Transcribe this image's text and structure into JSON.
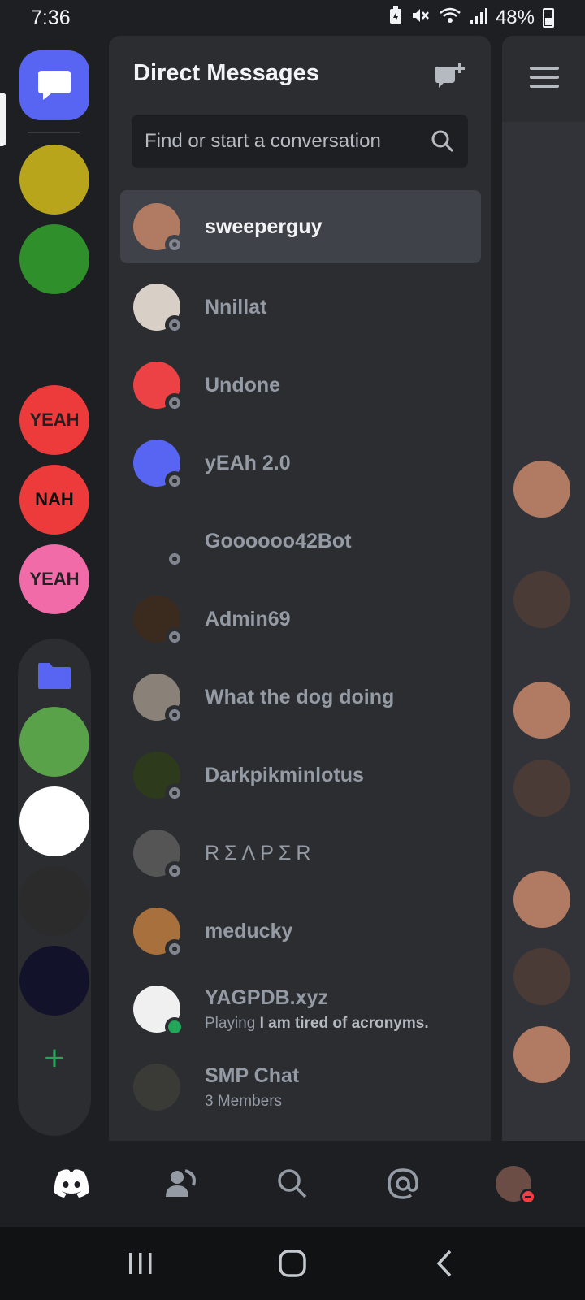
{
  "status_bar": {
    "time": "7:36",
    "battery": "48%"
  },
  "dm_panel": {
    "title": "Direct Messages",
    "search_placeholder": "Find or start a conversation"
  },
  "servers": [
    {
      "name": "server-yellow-pixel",
      "color": "#b8a51b",
      "text": ""
    },
    {
      "name": "server-green-creeper",
      "color": "#2f8f2b",
      "text": ""
    },
    {
      "name": "server-snake",
      "color": "#1e1f22",
      "text": ""
    },
    {
      "name": "server-yeah",
      "color": "#ed3a3a",
      "text": "YEAH"
    },
    {
      "name": "server-nah",
      "color": "#ed3a3a",
      "text": "NAH"
    },
    {
      "name": "server-yeah-pink",
      "color": "#f06ba8",
      "text": "YEAH"
    }
  ],
  "folder_servers": [
    {
      "name": "server-minecraft",
      "color": "#5aa24a"
    },
    {
      "name": "server-ramen",
      "color": "#ffffff"
    },
    {
      "name": "server-d-logo",
      "color": "#2b2b2b"
    },
    {
      "name": "server-galaxy",
      "color": "#12132a"
    }
  ],
  "dms": [
    {
      "name": "sweeperguy",
      "sub": "",
      "status": "offline",
      "active": true,
      "color": "#b07a63"
    },
    {
      "name": "Nnillat",
      "sub": "",
      "status": "offline",
      "active": false,
      "color": "#d8cfc7"
    },
    {
      "name": "Undone",
      "sub": "",
      "status": "offline",
      "active": false,
      "color": "#ed4245"
    },
    {
      "name": "yEAh 2.0",
      "sub": "",
      "status": "offline",
      "active": false,
      "color": "#5865f2"
    },
    {
      "name": "Goooooo42Bot",
      "sub": "",
      "status": "offline",
      "active": false,
      "color": "#2b2d31"
    },
    {
      "name": "Admin69",
      "sub": "",
      "status": "offline",
      "active": false,
      "color": "#3b2a1e"
    },
    {
      "name": "What the dog doing",
      "sub": "",
      "status": "offline",
      "active": false,
      "color": "#8a8279"
    },
    {
      "name": "Darkpikminlotus",
      "sub": "",
      "status": "offline",
      "active": false,
      "color": "#2e3a1c"
    },
    {
      "name": "RΣΛPΣR",
      "sub": "",
      "status": "offline",
      "active": false,
      "color": "#555555"
    },
    {
      "name": "meducky",
      "sub": "",
      "status": "offline",
      "active": false,
      "color": "#a8703c"
    },
    {
      "name": "YAGPDB.xyz",
      "sub_prefix": "Playing",
      "sub": "I am tired of acronyms.",
      "status": "online",
      "active": false,
      "color": "#f0f0f0"
    },
    {
      "name": "SMP Chat",
      "sub": "3 Members",
      "status": "none",
      "active": false,
      "color": "#3a3a36"
    }
  ],
  "colors": {
    "brand": "#5865f2",
    "online": "#23a55a",
    "dnd": "#f23f43",
    "offline": "#80848e"
  }
}
